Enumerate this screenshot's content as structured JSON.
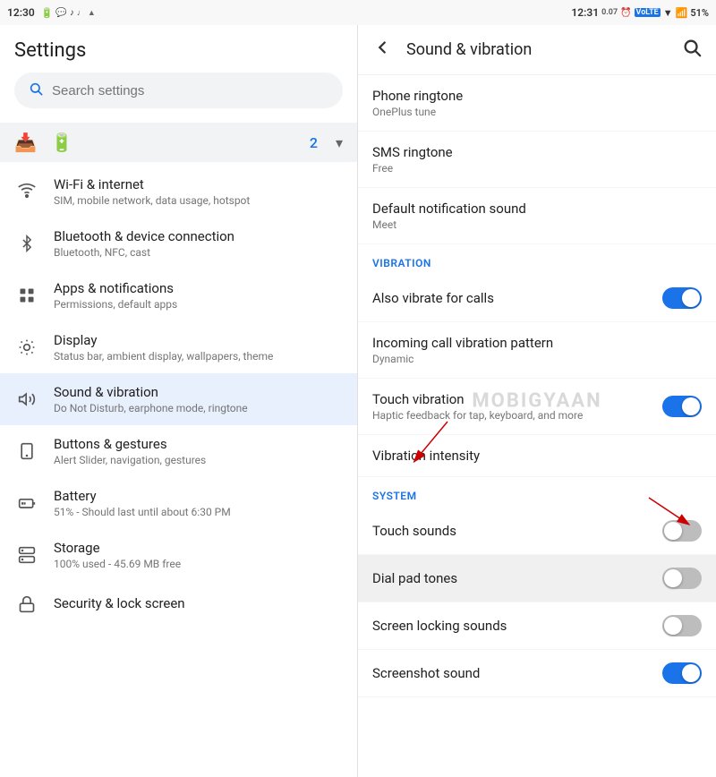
{
  "statusBar": {
    "left": {
      "time": "12:30",
      "icons": [
        "battery-icon",
        "whatsapp-icon",
        "notification-icon",
        "tiktok-icon",
        "music-icon",
        "dolby-icon"
      ]
    },
    "right": {
      "time": "12:31",
      "speed": "0.07",
      "icons": [
        "alarm-icon",
        "volte-icon",
        "wifi-icon",
        "signal-icon",
        "battery-icon"
      ],
      "battery": "51%"
    }
  },
  "leftPanel": {
    "title": "Settings",
    "searchPlaceholder": "Search settings",
    "badgeCount": "2",
    "items": [
      {
        "id": "wifi",
        "title": "Wi-Fi & internet",
        "subtitle": "SIM, mobile network, data usage, hotspot",
        "icon": "wifi"
      },
      {
        "id": "bluetooth",
        "title": "Bluetooth & device connection",
        "subtitle": "Bluetooth, NFC, cast",
        "icon": "bluetooth"
      },
      {
        "id": "apps",
        "title": "Apps & notifications",
        "subtitle": "Permissions, default apps",
        "icon": "apps"
      },
      {
        "id": "display",
        "title": "Display",
        "subtitle": "Status bar, ambient display, wallpapers, theme",
        "icon": "display"
      },
      {
        "id": "sound",
        "title": "Sound & vibration",
        "subtitle": "Do Not Disturb, earphone mode, ringtone",
        "icon": "sound",
        "active": true
      },
      {
        "id": "buttons",
        "title": "Buttons & gestures",
        "subtitle": "Alert Slider, navigation, gestures",
        "icon": "buttons"
      },
      {
        "id": "battery",
        "title": "Battery",
        "subtitle": "51% - Should last until about 6:30 PM",
        "icon": "battery"
      },
      {
        "id": "storage",
        "title": "Storage",
        "subtitle": "100% used - 45.69 MB free",
        "icon": "storage"
      },
      {
        "id": "security",
        "title": "Security & lock screen",
        "subtitle": "",
        "icon": "security"
      }
    ]
  },
  "rightPanel": {
    "title": "Sound & vibration",
    "sections": [
      {
        "type": "item",
        "title": "Phone ringtone",
        "subtitle": "OnePlus tune"
      },
      {
        "type": "item",
        "title": "SMS ringtone",
        "subtitle": "Free"
      },
      {
        "type": "item",
        "title": "Default notification sound",
        "subtitle": "Meet"
      }
    ],
    "vibrationSection": {
      "header": "VIBRATION",
      "items": [
        {
          "type": "toggle",
          "title": "Also vibrate for calls",
          "state": "on"
        },
        {
          "type": "item",
          "title": "Incoming call vibration pattern",
          "subtitle": "Dynamic"
        },
        {
          "type": "toggle",
          "title": "Touch vibration",
          "subtitle": "Haptic feedback for tap, keyboard, and more",
          "state": "on"
        },
        {
          "type": "item",
          "title": "Vibration intensity"
        }
      ]
    },
    "systemSection": {
      "header": "SYSTEM",
      "items": [
        {
          "type": "toggle",
          "title": "Touch sounds",
          "state": "off"
        },
        {
          "type": "toggle",
          "title": "Dial pad tones",
          "state": "off"
        },
        {
          "type": "toggle",
          "title": "Screen locking sounds",
          "state": "off"
        },
        {
          "type": "toggle",
          "title": "Screenshot sound",
          "state": "on"
        }
      ]
    },
    "watermark": "MOBIGYAAN"
  }
}
